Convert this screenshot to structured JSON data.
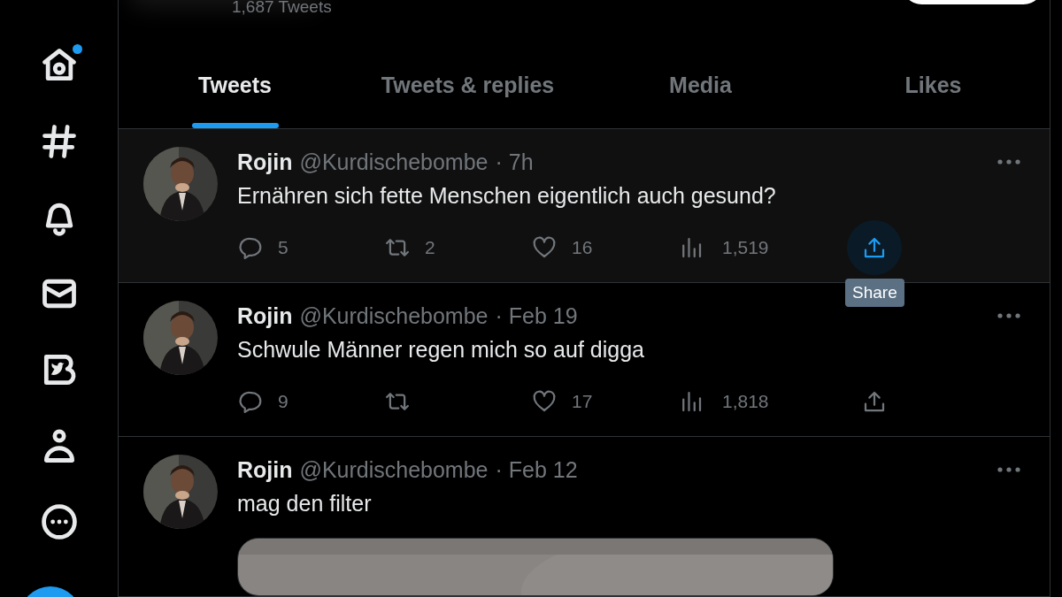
{
  "sidebar": {
    "items": [
      {
        "kind": "home",
        "badge": true
      },
      {
        "kind": "explore",
        "badge": false
      },
      {
        "kind": "notifications",
        "badge": false
      },
      {
        "kind": "messages",
        "badge": false
      },
      {
        "kind": "blue",
        "badge": false
      },
      {
        "kind": "profile",
        "badge": false
      },
      {
        "kind": "more",
        "badge": false
      }
    ]
  },
  "header": {
    "tweet_count": "1,687 Tweets"
  },
  "tabs": [
    {
      "label": "Tweets",
      "selected": true
    },
    {
      "label": "Tweets & replies",
      "selected": false
    },
    {
      "label": "Media",
      "selected": false
    },
    {
      "label": "Likes",
      "selected": false
    }
  ],
  "tweets": [
    {
      "name": "Rojin",
      "handle": "@Kurdischebombe",
      "time": "· 7h",
      "text": "Ernähren sich fette Menschen eigentlich auch gesund?",
      "replies": "5",
      "retweets": "2",
      "likes": "16",
      "views": "1,519",
      "hovered": true,
      "share_hovered": true,
      "tooltip": "Share"
    },
    {
      "name": "Rojin",
      "handle": "@Kurdischebombe",
      "time": "· Feb 19",
      "text": "Schwule Männer regen mich so auf digga",
      "replies": "9",
      "likes": "17",
      "views": "1,818",
      "hovered": false,
      "share_hovered": false
    },
    {
      "name": "Rojin",
      "handle": "@Kurdischebombe",
      "time": "· Feb 12",
      "text": "mag den filter",
      "hovered": false
    }
  ]
}
